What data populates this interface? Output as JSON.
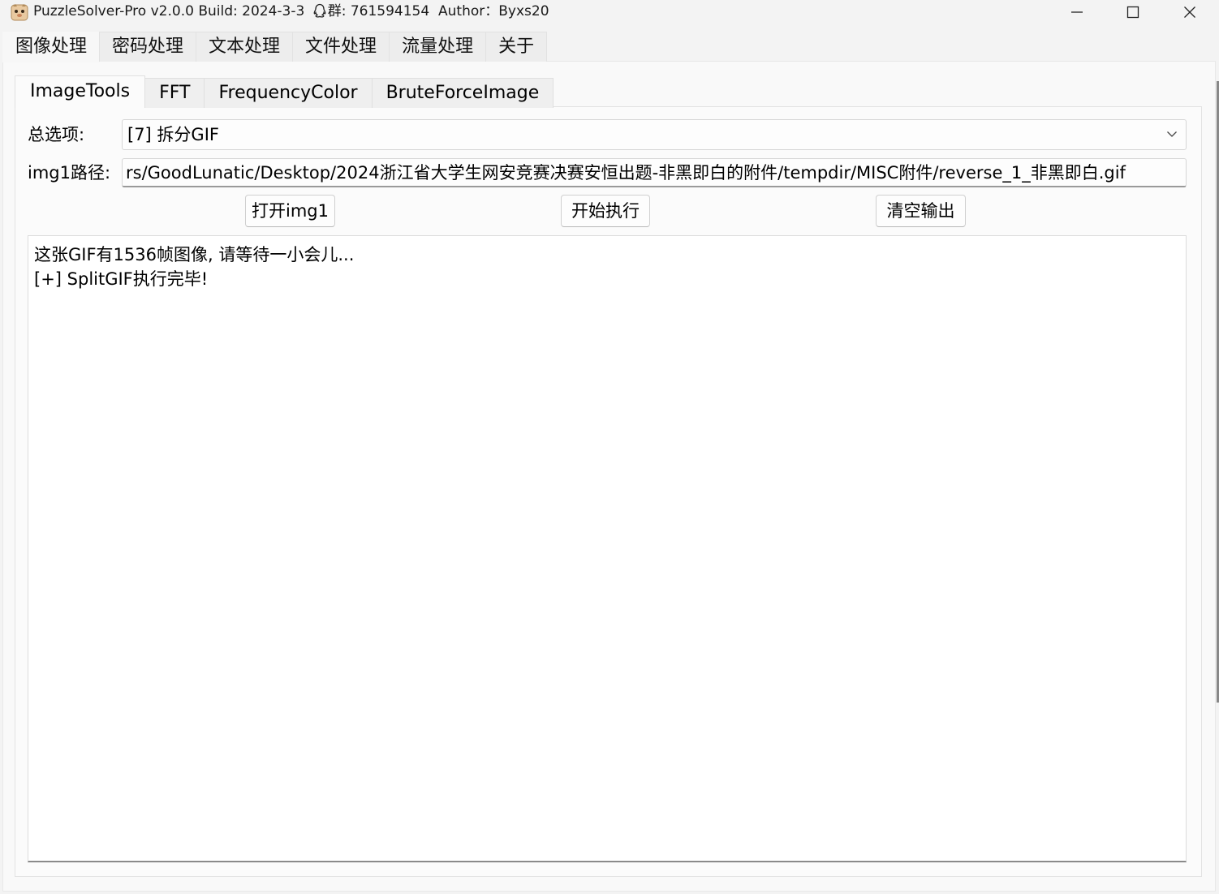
{
  "window": {
    "title": "PuzzleSolver-Pro v2.0.0 Build: 2024-3-3",
    "group_label": "群: 761594154",
    "author_label": "Author：Byxs20",
    "icons": {
      "app": "puzzle-solver-app-icon",
      "qq": "qq-penguin-icon"
    }
  },
  "top_tabs": [
    {
      "label": "图像处理",
      "active": true
    },
    {
      "label": "密码处理",
      "active": false
    },
    {
      "label": "文本处理",
      "active": false
    },
    {
      "label": "文件处理",
      "active": false
    },
    {
      "label": "流量处理",
      "active": false
    },
    {
      "label": "关于",
      "active": false
    }
  ],
  "sub_tabs": [
    {
      "label": "ImageTools",
      "active": true
    },
    {
      "label": "FFT",
      "active": false
    },
    {
      "label": "FrequencyColor",
      "active": false
    },
    {
      "label": "BruteForceImage",
      "active": false
    }
  ],
  "form": {
    "option_label": "总选项:",
    "option_value": "[7] 拆分GIF",
    "path_label": "img1路径:",
    "path_value": "rs/GoodLunatic/Desktop/2024浙江省大学生网安竞赛决赛安恒出题-非黑即白的附件/tempdir/MISC附件/reverse_1_非黑即白.gif"
  },
  "buttons": {
    "open_img1": "打开img1",
    "execute": "开始执行",
    "clear_output": "清空输出"
  },
  "output": {
    "lines": [
      "这张GIF有1536帧图像, 请等待一小会儿...",
      "[+] SplitGIF执行完毕!"
    ]
  }
}
